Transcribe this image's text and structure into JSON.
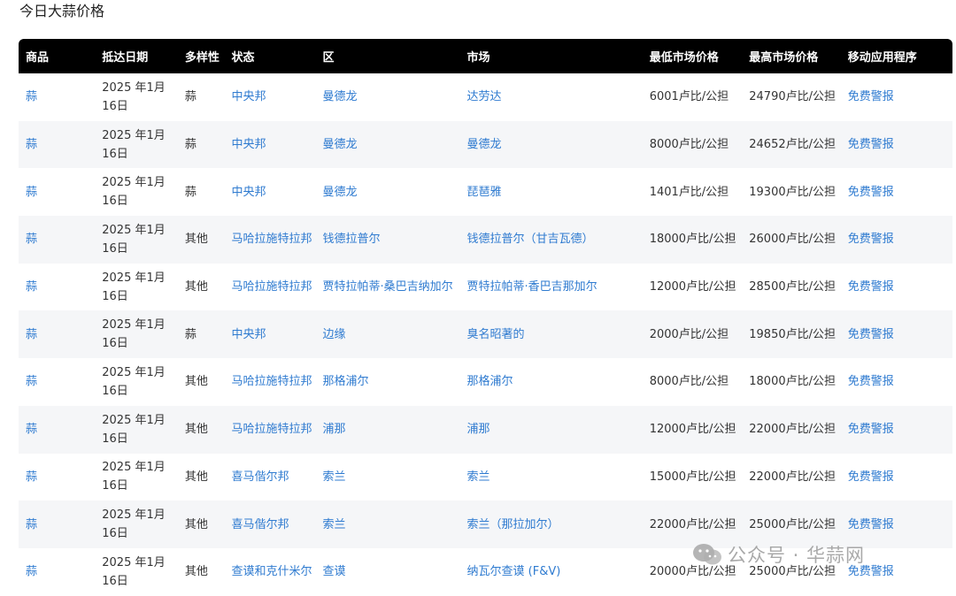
{
  "page": {
    "title": "今日大蒜价格"
  },
  "table": {
    "headers": [
      "商品",
      "抵达日期",
      "多样性",
      "状态",
      "区",
      "市场",
      "最低市场价格",
      "最高市场价格",
      "移动应用程序"
    ],
    "rows": [
      {
        "commodity": "蒜",
        "date": "2025 年1月 16日",
        "variety": "蒜",
        "state": "中央邦",
        "district": "曼德龙",
        "market": "达劳达",
        "min_price": "6001卢比/公担",
        "max_price": "24790卢比/公担",
        "app": "免费警报"
      },
      {
        "commodity": "蒜",
        "date": "2025 年1月 16日",
        "variety": "蒜",
        "state": "中央邦",
        "district": "曼德龙",
        "market": "曼德龙",
        "min_price": "8000卢比/公担",
        "max_price": "24652卢比/公担",
        "app": "免费警报"
      },
      {
        "commodity": "蒜",
        "date": "2025 年1月 16日",
        "variety": "蒜",
        "state": "中央邦",
        "district": "曼德龙",
        "market": "琵琶雅",
        "min_price": "1401卢比/公担",
        "max_price": "19300卢比/公担",
        "app": "免费警报"
      },
      {
        "commodity": "蒜",
        "date": "2025 年1月 16日",
        "variety": "其他",
        "state": "马哈拉施特拉邦",
        "district": "钱德拉普尔",
        "market": "钱德拉普尔（甘吉瓦德）",
        "min_price": "18000卢比/公担",
        "max_price": "26000卢比/公担",
        "app": "免费警报"
      },
      {
        "commodity": "蒜",
        "date": "2025 年1月 16日",
        "variety": "其他",
        "state": "马哈拉施特拉邦",
        "district": "贾特拉帕蒂·桑巴吉纳加尔",
        "market": "贾特拉帕蒂·香巴吉那加尔",
        "min_price": "12000卢比/公担",
        "max_price": "28500卢比/公担",
        "app": "免费警报"
      },
      {
        "commodity": "蒜",
        "date": "2025 年1月 16日",
        "variety": "蒜",
        "state": "中央邦",
        "district": "边缘",
        "market": "臭名昭著的",
        "min_price": "2000卢比/公担",
        "max_price": "19850卢比/公担",
        "app": "免费警报"
      },
      {
        "commodity": "蒜",
        "date": "2025 年1月 16日",
        "variety": "其他",
        "state": "马哈拉施特拉邦",
        "district": "那格浦尔",
        "market": "那格浦尔",
        "min_price": "8000卢比/公担",
        "max_price": "18000卢比/公担",
        "app": "免费警报"
      },
      {
        "commodity": "蒜",
        "date": "2025 年1月 16日",
        "variety": "其他",
        "state": "马哈拉施特拉邦",
        "district": "浦那",
        "market": "浦那",
        "min_price": "12000卢比/公担",
        "max_price": "22000卢比/公担",
        "app": "免费警报"
      },
      {
        "commodity": "蒜",
        "date": "2025 年1月 16日",
        "variety": "其他",
        "state": "喜马偕尔邦",
        "district": "索兰",
        "market": "索兰",
        "min_price": "15000卢比/公担",
        "max_price": "22000卢比/公担",
        "app": "免费警报"
      },
      {
        "commodity": "蒜",
        "date": "2025 年1月 16日",
        "variety": "其他",
        "state": "喜马偕尔邦",
        "district": "索兰",
        "market": "索兰（那拉加尔）",
        "min_price": "22000卢比/公担",
        "max_price": "25000卢比/公担",
        "app": "免费警报"
      },
      {
        "commodity": "蒜",
        "date": "2025 年1月 16日",
        "variety": "其他",
        "state": "查谟和克什米尔",
        "district": "查谟",
        "market": "纳瓦尔查谟 (F&V)",
        "min_price": "20000卢比/公担",
        "max_price": "25000卢比/公担",
        "app": "免费警报"
      }
    ]
  },
  "watermark": {
    "text": "公众号 · 华蒜网",
    "icon": "wechat-icon"
  },
  "colors": {
    "header_bg": "#000000",
    "link": "#2f7bd0",
    "stripe": "#f5f6f8"
  }
}
